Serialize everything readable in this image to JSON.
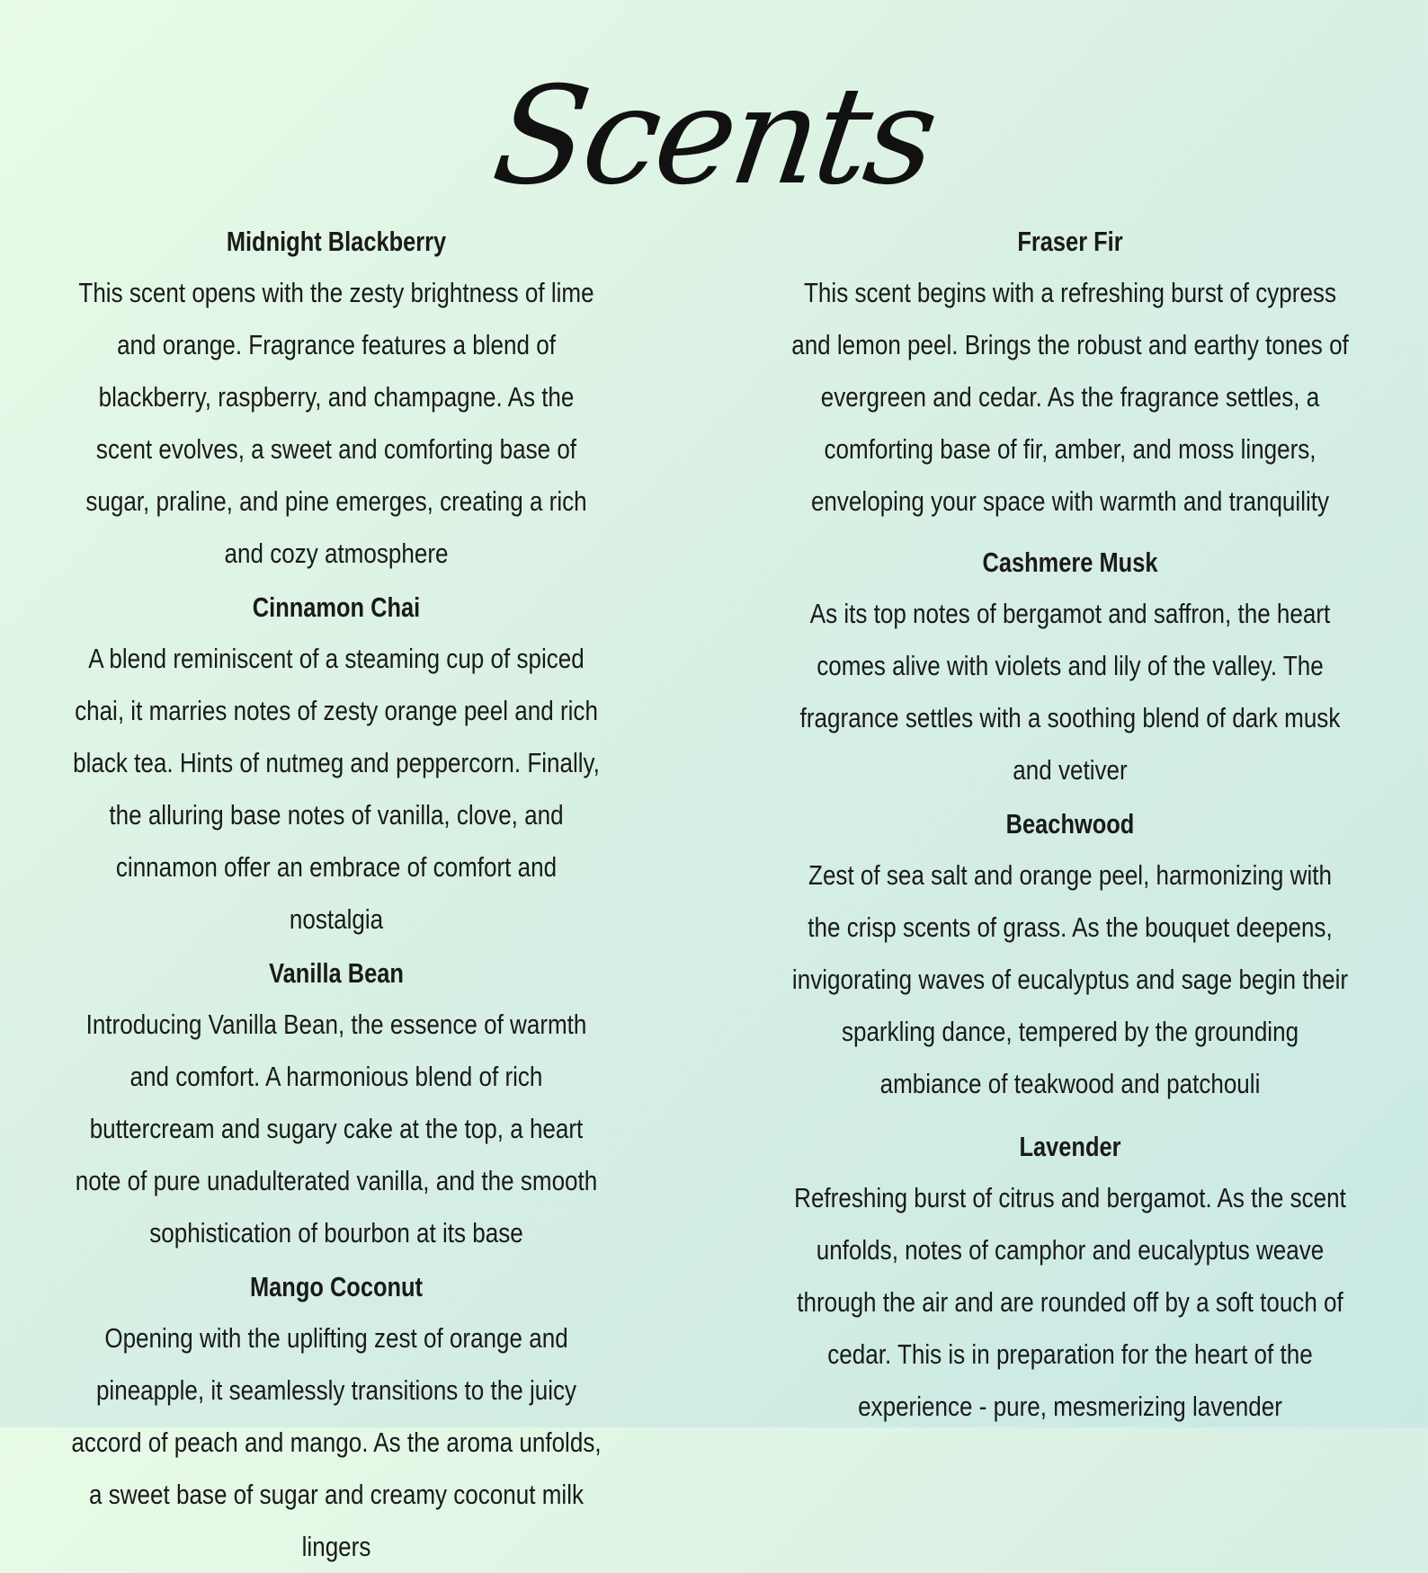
{
  "title": "Scents",
  "left_column": [
    {
      "name": "Midnight Blackberry",
      "description": "This scent opens with the zesty brightness of lime and orange. Fragrance features a blend of blackberry, raspberry, and champagne. As the scent evolves, a sweet and comforting base of sugar, praline, and pine emerges, creating a rich and cozy atmosphere"
    },
    {
      "name": "Cinnamon Chai",
      "description": "A blend reminiscent of a steaming cup of spiced chai, it marries notes of zesty orange peel and rich black tea. Hints of nutmeg and peppercorn. Finally, the alluring base notes of vanilla, clove, and cinnamon offer an embrace of comfort and nostalgia"
    },
    {
      "name": "Vanilla Bean",
      "description": "Introducing Vanilla Bean, the essence of warmth and comfort. A harmonious blend of rich buttercream and sugary cake at the top, a heart note of pure unadulterated vanilla, and the smooth sophistication of bourbon at its base"
    },
    {
      "name": "Mango Coconut",
      "description": "Opening with the uplifting zest of orange and pineapple, it seamlessly transitions to the juicy accord of peach and mango. As the aroma unfolds, a sweet base of sugar and creamy coconut milk lingers"
    }
  ],
  "right_column": [
    {
      "name": "Fraser Fir",
      "description": "This scent begins with a refreshing burst of cypress and lemon peel. Brings the robust and earthy tones of evergreen and cedar. As the fragrance settles, a comforting base of fir, amber, and moss lingers, enveloping your space with warmth and tranquility"
    },
    {
      "name": "Cashmere Musk",
      "description": "As its top notes of bergamot and saffron, the heart comes alive with violets and lily of the valley. The fragrance settles with a soothing blend of dark musk and vetiver"
    },
    {
      "name": "Beachwood",
      "description": "Zest of sea salt and orange peel, harmonizing with the crisp scents of grass. As the bouquet deepens, invigorating waves of eucalyptus and sage begin their sparkling dance, tempered by the grounding ambiance of teakwood and patchouli"
    },
    {
      "name": "Lavender",
      "description": "Refreshing burst of citrus and bergamot. As the scent unfolds, notes of camphor and eucalyptus weave through the air and are rounded off by a soft touch of cedar. This is in preparation for the heart of the experience - pure, mesmerizing lavender"
    }
  ]
}
